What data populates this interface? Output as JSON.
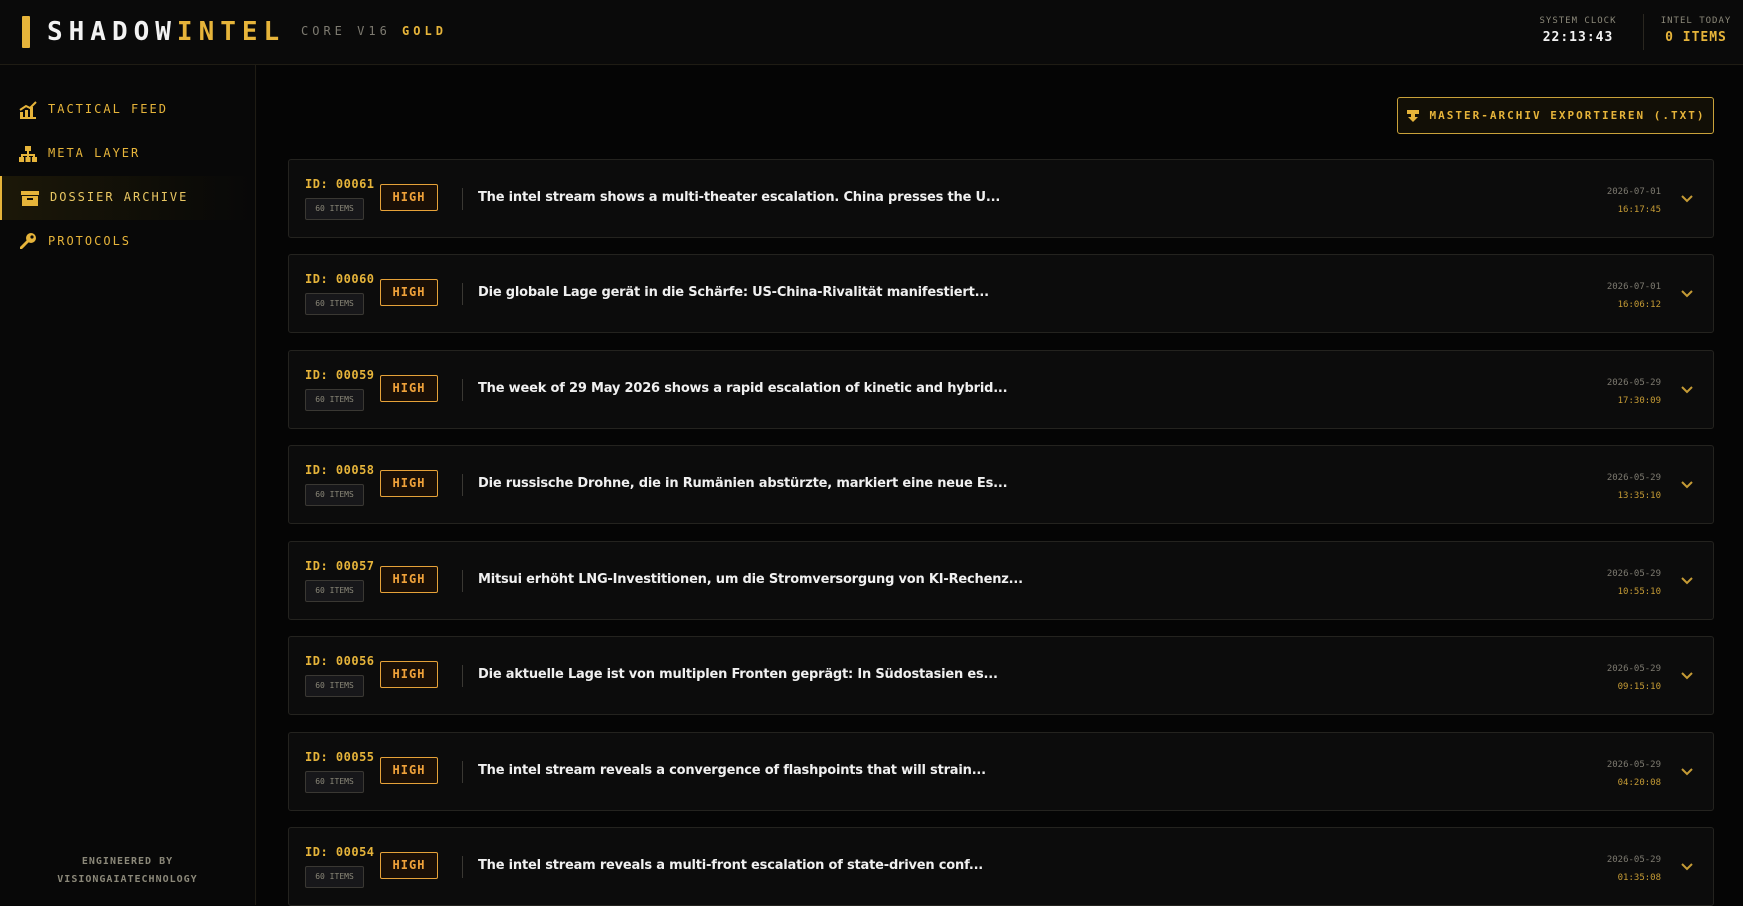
{
  "header": {
    "brand_part1": "SHADOW",
    "brand_part2": "INTEL",
    "core_label": "CORE V16",
    "core_edition": "GOLD",
    "clock_label": "SYSTEM CLOCK",
    "clock_value": "22:13:43",
    "intel_label": "INTEL TODAY",
    "intel_value": "0 ITEMS"
  },
  "sidebar": {
    "items": [
      {
        "label": "TACTICAL FEED",
        "icon": "chart-icon",
        "active": false
      },
      {
        "label": "META LAYER",
        "icon": "hierarchy-icon",
        "active": false
      },
      {
        "label": "DOSSIER ARCHIVE",
        "icon": "archive-box-icon",
        "active": true
      },
      {
        "label": "PROTOCOLS",
        "icon": "key-icon",
        "active": false
      }
    ],
    "footer_line1": "ENGINEERED BY",
    "footer_line2": "VISIONGAIATECHNOLOGY"
  },
  "main": {
    "export_label": "MASTER-ARCHIV EXPORTIEREN (.TXT)",
    "dossiers": [
      {
        "id": "ID: 00061",
        "items": "60 ITEMS",
        "priority": "HIGH",
        "summary": "The intel stream shows a multi-theater escalation. China presses the U...",
        "date": "2026-07-01",
        "time": "16:17:45"
      },
      {
        "id": "ID: 00060",
        "items": "60 ITEMS",
        "priority": "HIGH",
        "summary": "Die globale Lage gerät in die Schärfe: US-China-Rivalität manifestiert...",
        "date": "2026-07-01",
        "time": "16:06:12"
      },
      {
        "id": "ID: 00059",
        "items": "60 ITEMS",
        "priority": "HIGH",
        "summary": "The week of 29 May 2026 shows a rapid escalation of kinetic and hybrid...",
        "date": "2026-05-29",
        "time": "17:30:09"
      },
      {
        "id": "ID: 00058",
        "items": "60 ITEMS",
        "priority": "HIGH",
        "summary": "Die russische Drohne, die in Rumänien abstürzte, markiert eine neue Es...",
        "date": "2026-05-29",
        "time": "13:35:10"
      },
      {
        "id": "ID: 00057",
        "items": "60 ITEMS",
        "priority": "HIGH",
        "summary": "Mitsui erhöht LNG-Investitionen, um die Stromversorgung von KI-Rechenz...",
        "date": "2026-05-29",
        "time": "10:55:10"
      },
      {
        "id": "ID: 00056",
        "items": "60 ITEMS",
        "priority": "HIGH",
        "summary": "Die aktuelle Lage ist von multiplen Fronten geprägt: In Südostasien es...",
        "date": "2026-05-29",
        "time": "09:15:10"
      },
      {
        "id": "ID: 00055",
        "items": "60 ITEMS",
        "priority": "HIGH",
        "summary": "The intel stream reveals a convergence of flashpoints that will strain...",
        "date": "2026-05-29",
        "time": "04:20:08"
      },
      {
        "id": "ID: 00054",
        "items": "60 ITEMS",
        "priority": "HIGH",
        "summary": "The intel stream reveals a multi-front escalation of state-driven conf...",
        "date": "2026-05-29",
        "time": "01:35:08"
      }
    ]
  },
  "colors": {
    "accent_gold": "#e6b43a",
    "priority_orange": "#f0a23a",
    "background": "#060606"
  }
}
